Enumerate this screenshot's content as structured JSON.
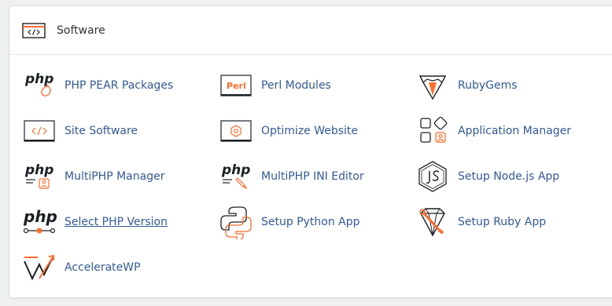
{
  "section": {
    "title": "Software",
    "icon": "code-window-icon"
  },
  "colors": {
    "link": "#325995",
    "accent": "#ff6c2c",
    "dark": "#1c2125"
  },
  "items": [
    {
      "label": "PHP PEAR Packages",
      "icon": "php-pear-icon"
    },
    {
      "label": "Perl Modules",
      "icon": "perl-icon"
    },
    {
      "label": "RubyGems",
      "icon": "rubygems-icon"
    },
    {
      "label": "Site Software",
      "icon": "code-window-icon"
    },
    {
      "label": "Optimize Website",
      "icon": "optimize-website-icon"
    },
    {
      "label": "Application Manager",
      "icon": "application-manager-icon"
    },
    {
      "label": "MultiPHP Manager",
      "icon": "multiphp-manager-icon"
    },
    {
      "label": "MultiPHP INI Editor",
      "icon": "multiphp-ini-editor-icon"
    },
    {
      "label": "Setup Node.js App",
      "icon": "nodejs-icon"
    },
    {
      "label": "Select PHP Version",
      "icon": "select-php-version-icon"
    },
    {
      "label": "Setup Python App",
      "icon": "python-icon"
    },
    {
      "label": "Setup Ruby App",
      "icon": "ruby-app-icon"
    },
    {
      "label": "AccelerateWP",
      "icon": "acceleratewp-icon"
    }
  ],
  "icon_text": {
    "php": "php",
    "perl": "Perl"
  }
}
